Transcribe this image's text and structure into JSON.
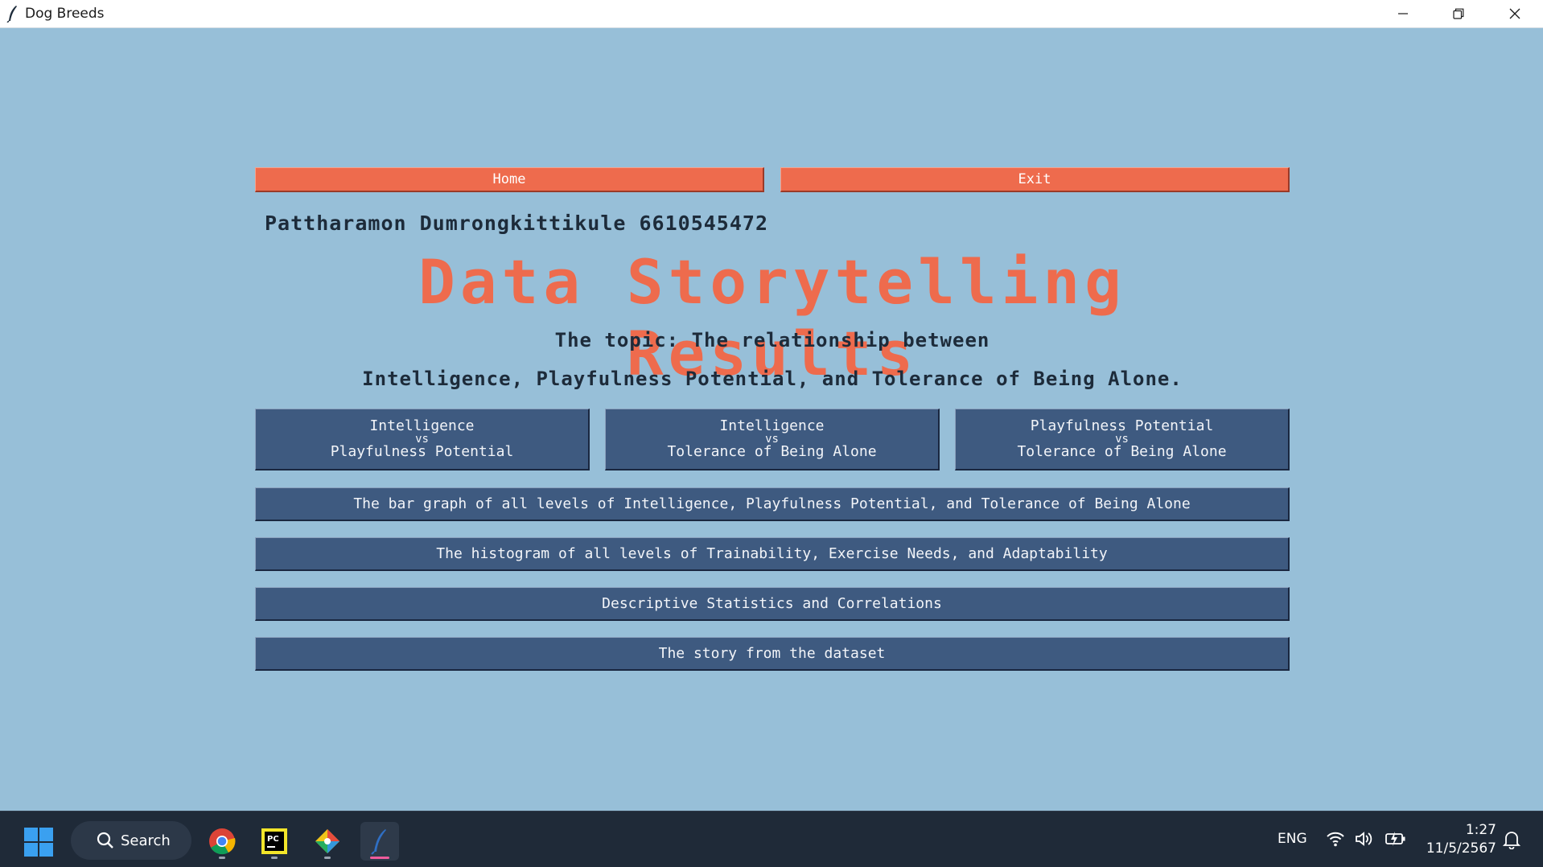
{
  "window": {
    "title": "Dog Breeds"
  },
  "top_buttons": {
    "home": "Home",
    "exit": "Exit"
  },
  "author": "Pattharamon Dumrongkittikule 6610545472",
  "main_title": "Data Storytelling Results",
  "topic": {
    "line1": "The topic: The relationship between",
    "line2": "Intelligence, Playfulness Potential, and Tolerance of Being Alone."
  },
  "comparison_buttons": [
    {
      "a": "Intelligence",
      "vs": "vs",
      "b": "Playfulness Potential"
    },
    {
      "a": "Intelligence",
      "vs": "vs",
      "b": "Tolerance of Being Alone"
    },
    {
      "a": "Playfulness Potential",
      "vs": "vs",
      "b": "Tolerance of Being Alone"
    }
  ],
  "wide_buttons": [
    "The bar graph of all levels of Intelligence, Playfulness Potential, and Tolerance of Being Alone",
    "The histogram of all levels of Trainability, Exercise Needs, and Adaptability",
    "Descriptive Statistics and Correlations",
    "The story from the dataset"
  ],
  "colors": {
    "background": "#97bfd8",
    "accent_orange": "#ee6b4d",
    "button_blue": "#3e5a80",
    "text_dark": "#1d2b3a"
  },
  "taskbar": {
    "search_label": "Search",
    "language": "ENG",
    "time": "1:27",
    "date": "11/5/2567",
    "apps": [
      "chrome-icon",
      "pycharm-icon",
      "git-icon",
      "python-feather-icon"
    ]
  }
}
